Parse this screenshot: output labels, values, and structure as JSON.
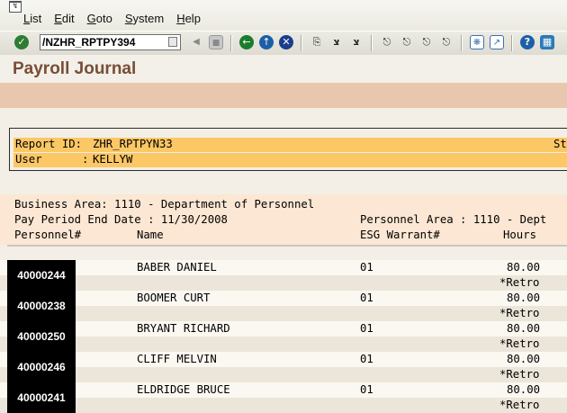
{
  "menu": {
    "items": [
      {
        "acc": "L",
        "rest": "ist"
      },
      {
        "acc": "E",
        "rest": "dit"
      },
      {
        "acc": "G",
        "rest": "oto"
      },
      {
        "acc": "S",
        "rest": "ystem"
      },
      {
        "acc": "H",
        "rest": "elp"
      }
    ]
  },
  "toolbar": {
    "command": "/NZHR_RPTPY394",
    "icons": [
      "enter-icon",
      "back-icon",
      "save-icon",
      "back-nav-icon",
      "exit-icon",
      "cancel-icon",
      "print-icon",
      "find-icon",
      "find-next-icon",
      "first-page-icon",
      "prev-page-icon",
      "next-page-icon",
      "last-page-icon",
      "create-session-icon",
      "shortcut-icon",
      "help-icon",
      "customize-layout-icon"
    ]
  },
  "title": "Payroll Journal",
  "report": {
    "report_id_label": "Report ID:",
    "report_id": "ZHR_RPTPYN33",
    "report_id_trail": "St",
    "user_label": "User      :",
    "user": "KELLYW",
    "business_area": "Business Area: 1110 - Department of Personnel",
    "pay_period": "Pay Period End Date : 11/30/2008",
    "personnel_area": "Personnel Area : 1110 - Dept",
    "columns": {
      "personnel": "Personnel#",
      "name": "Name",
      "esg": "ESG Warrant#",
      "hours": "Hours"
    },
    "rows": [
      {
        "pernr": "40000244",
        "name": "BABER DANIEL",
        "esg": "01",
        "hours": "80.00",
        "note": "*Retro"
      },
      {
        "pernr": "40000238",
        "name": "BOOMER CURT",
        "esg": "01",
        "hours": "80.00",
        "note": "*Retro"
      },
      {
        "pernr": "40000250",
        "name": "BRYANT RICHARD",
        "esg": "01",
        "hours": "80.00",
        "note": "*Retro"
      },
      {
        "pernr": "40000246",
        "name": "CLIFF MELVIN",
        "esg": "01",
        "hours": "80.00",
        "note": "*Retro"
      },
      {
        "pernr": "40000241",
        "name": "ELDRIDGE BRUCE",
        "esg": "01",
        "hours": "80.00",
        "note": "*Retro"
      }
    ]
  },
  "colors": {
    "title": "#7a4d36",
    "band": "#e9c7ae",
    "header_highlight": "#fcc765",
    "pernr_bg": "#000000"
  }
}
